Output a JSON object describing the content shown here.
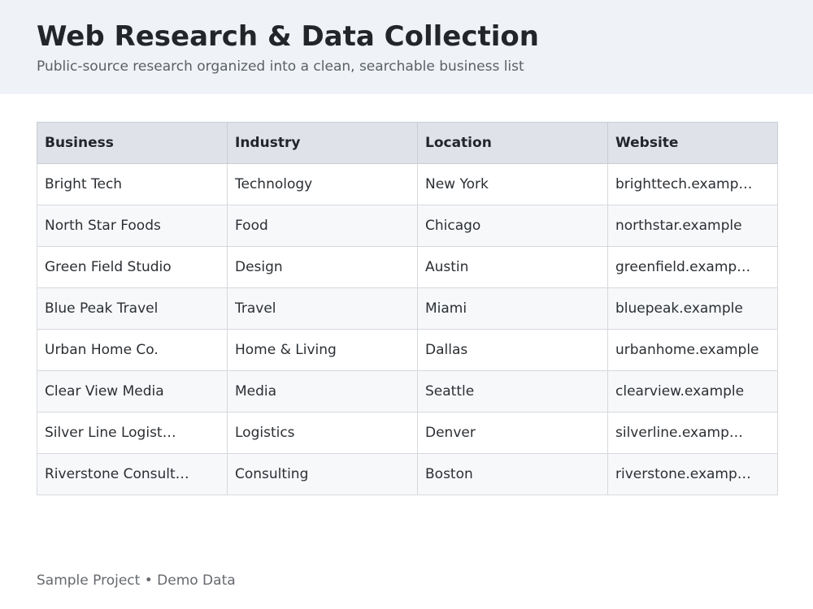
{
  "header": {
    "title": "Web Research & Data Collection",
    "subtitle": "Public-source research organized into a clean, searchable business list"
  },
  "table": {
    "columns": [
      "Business",
      "Industry",
      "Location",
      "Website"
    ],
    "rows": [
      [
        "Bright Tech",
        "Technology",
        "New York",
        "brighttech.examp…"
      ],
      [
        "North Star Foods",
        "Food",
        "Chicago",
        "northstar.example"
      ],
      [
        "Green Field Studio",
        "Design",
        "Austin",
        "greenfield.examp…"
      ],
      [
        "Blue Peak Travel",
        "Travel",
        "Miami",
        "bluepeak.example"
      ],
      [
        "Urban Home Co.",
        "Home & Living",
        "Dallas",
        "urbanhome.example"
      ],
      [
        "Clear View Media",
        "Media",
        "Seattle",
        "clearview.example"
      ],
      [
        "Silver Line Logist…",
        "Logistics",
        "Denver",
        "silverline.examp…"
      ],
      [
        "Riverstone Consult…",
        "Consulting",
        "Boston",
        "riverstone.examp…"
      ]
    ]
  },
  "footer": {
    "text": "Sample Project • Demo Data"
  },
  "colors": {
    "header_bg": "#eff2f6",
    "table_header_bg": "#dfe3e9",
    "stripe_bg": "#f7f8fa",
    "border": "#d6d9dd"
  }
}
